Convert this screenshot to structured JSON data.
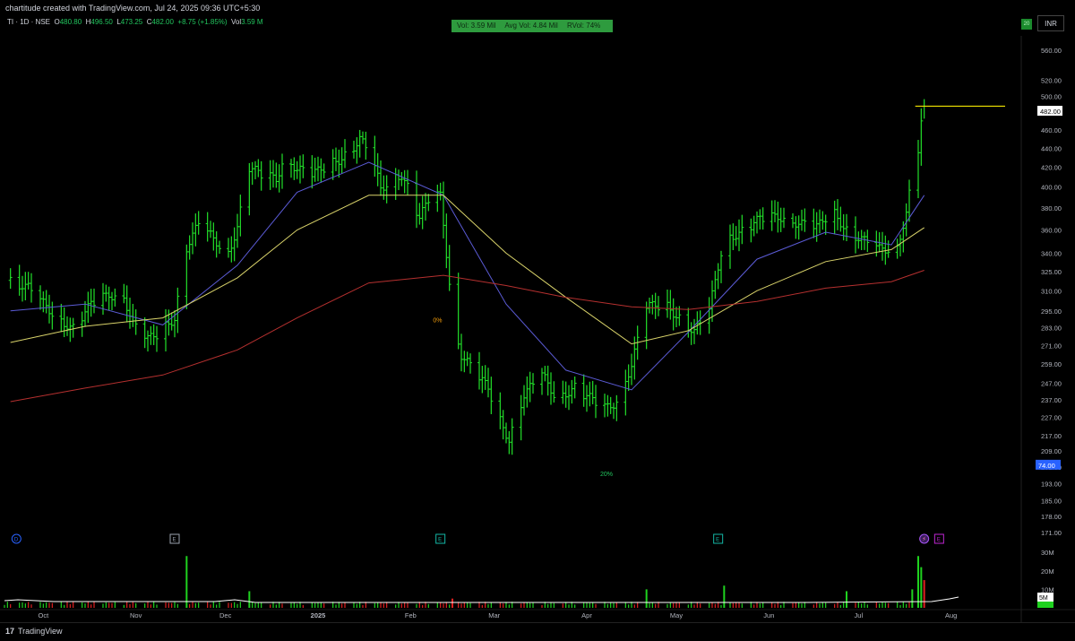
{
  "header": {
    "attribution": "chartitude created with TradingView.com, Jul 24, 2025 09:36 UTC+5:30",
    "symbol": "TI · 1D · NSE",
    "o_label": "O",
    "o_value": "480.80",
    "h_label": "H",
    "h_value": "496.50",
    "l_label": "L",
    "l_value": "473.25",
    "c_label": "C",
    "c_value": "482.00",
    "change": "+8.75 (+1.85%)",
    "vol_label": "Vol",
    "vol_value": "3.59 M",
    "badge": "20",
    "currency": "INR"
  },
  "volume_box": {
    "vol": "Vol: 3.59 Mil",
    "avg_vol": "Avg Vol: 4.84 Mil",
    "rvol": "RVol: 74%"
  },
  "footer": {
    "brand": "TradingView",
    "brand_mark": "17"
  },
  "colors": {
    "background": "#000000",
    "candle_up": "#22e02a",
    "ma_fast": "#5b5bd6",
    "ma_mid": "#d9d36a",
    "ma_slow": "#b5302f",
    "price_line": "#f2e400",
    "vol_up": "#1fd21f",
    "vol_down": "#e02020",
    "vol_avg": "#ffffff",
    "price_label_bg": "#ffffff",
    "blue_label_bg": "#2962ff"
  },
  "chart_data": {
    "type": "ohlc",
    "title": "TI · 1D · NSE",
    "x_tick_labels": [
      "Oct",
      "Nov",
      "Dec",
      "2025",
      "Feb",
      "Mar",
      "Apr",
      "May",
      "Jun",
      "Jul",
      "Aug"
    ],
    "y_tick_labels": [
      "560.00",
      "520.00",
      "500.00",
      "460.00",
      "440.00",
      "420.00",
      "400.00",
      "380.00",
      "360.00",
      "340.00",
      "325.00",
      "310.00",
      "295.00",
      "283.00",
      "271.00",
      "259.00",
      "247.00",
      "237.00",
      "227.00",
      "217.00",
      "209.00",
      "201.00",
      "193.00",
      "185.00",
      "178.00",
      "171.00"
    ],
    "price_scale": "log",
    "y_range": [
      165,
      600
    ],
    "last_price_label": "482.00",
    "blue_label": "74.00",
    "annotations": [
      {
        "text": "20%",
        "date": "2025-04-07",
        "price": 200
      },
      {
        "text": "0%",
        "date": "2025-02-10",
        "price": 292
      }
    ],
    "price_series": [
      {
        "date": "2024-09-20",
        "close": 318
      },
      {
        "date": "2024-09-26",
        "close": 312
      },
      {
        "date": "2024-10-01",
        "close": 300
      },
      {
        "date": "2024-10-07",
        "close": 288
      },
      {
        "date": "2024-10-11",
        "close": 282
      },
      {
        "date": "2024-10-17",
        "close": 300
      },
      {
        "date": "2024-10-23",
        "close": 307
      },
      {
        "date": "2024-10-28",
        "close": 306
      },
      {
        "date": "2024-10-31",
        "close": 285
      },
      {
        "date": "2024-11-05",
        "close": 275
      },
      {
        "date": "2024-11-09",
        "close": 280
      },
      {
        "date": "2024-11-14",
        "close": 290
      },
      {
        "date": "2024-11-18",
        "close": 345
      },
      {
        "date": "2024-11-22",
        "close": 365
      },
      {
        "date": "2024-11-27",
        "close": 352
      },
      {
        "date": "2024-12-02",
        "close": 340
      },
      {
        "date": "2024-12-05",
        "close": 362
      },
      {
        "date": "2024-12-09",
        "close": 420
      },
      {
        "date": "2024-12-13",
        "close": 412
      },
      {
        "date": "2024-12-18",
        "close": 408
      },
      {
        "date": "2024-12-21",
        "close": 432
      },
      {
        "date": "2024-12-25",
        "close": 418
      },
      {
        "date": "2024-12-30",
        "close": 412
      },
      {
        "date": "2025-01-03",
        "close": 420
      },
      {
        "date": "2025-01-08",
        "close": 428
      },
      {
        "date": "2025-01-12",
        "close": 438
      },
      {
        "date": "2025-01-15",
        "close": 450
      },
      {
        "date": "2025-01-19",
        "close": 430
      },
      {
        "date": "2025-01-22",
        "close": 398
      },
      {
        "date": "2025-01-26",
        "close": 410
      },
      {
        "date": "2025-01-29",
        "close": 412
      },
      {
        "date": "2025-02-01",
        "close": 392
      },
      {
        "date": "2025-02-04",
        "close": 370
      },
      {
        "date": "2025-02-07",
        "close": 388
      },
      {
        "date": "2025-02-11",
        "close": 392
      },
      {
        "date": "2025-02-15",
        "close": 290
      },
      {
        "date": "2025-02-18",
        "close": 265
      },
      {
        "date": "2025-02-23",
        "close": 252
      },
      {
        "date": "2025-02-27",
        "close": 244
      },
      {
        "date": "2025-03-03",
        "close": 225
      },
      {
        "date": "2025-03-06",
        "close": 215
      },
      {
        "date": "2025-03-11",
        "close": 240
      },
      {
        "date": "2025-03-17",
        "close": 252
      },
      {
        "date": "2025-03-22",
        "close": 238
      },
      {
        "date": "2025-03-28",
        "close": 244
      },
      {
        "date": "2025-04-02",
        "close": 238
      },
      {
        "date": "2025-04-07",
        "close": 232
      },
      {
        "date": "2025-04-11",
        "close": 236
      },
      {
        "date": "2025-04-16",
        "close": 258
      },
      {
        "date": "2025-04-21",
        "close": 298
      },
      {
        "date": "2025-04-27",
        "close": 300
      },
      {
        "date": "2025-05-02",
        "close": 290
      },
      {
        "date": "2025-05-07",
        "close": 280
      },
      {
        "date": "2025-05-12",
        "close": 295
      },
      {
        "date": "2025-05-17",
        "close": 352
      },
      {
        "date": "2025-05-23",
        "close": 358
      },
      {
        "date": "2025-05-29",
        "close": 370
      },
      {
        "date": "2025-06-05",
        "close": 372
      },
      {
        "date": "2025-06-12",
        "close": 365
      },
      {
        "date": "2025-06-17",
        "close": 362
      },
      {
        "date": "2025-06-22",
        "close": 378
      },
      {
        "date": "2025-06-27",
        "close": 360
      },
      {
        "date": "2025-07-03",
        "close": 350
      },
      {
        "date": "2025-07-08",
        "close": 343
      },
      {
        "date": "2025-07-14",
        "close": 345
      },
      {
        "date": "2025-07-17",
        "close": 375
      },
      {
        "date": "2025-07-19",
        "close": 410
      },
      {
        "date": "2025-07-21",
        "close": 440
      },
      {
        "date": "2025-07-22",
        "close": 470
      },
      {
        "date": "2025-07-23",
        "close": 482
      }
    ],
    "moving_averages": [
      {
        "name": "",
        "color_key": "ma_fast",
        "points": [
          {
            "date": "2024-09-20",
            "value": 295
          },
          {
            "date": "2024-10-15",
            "value": 300
          },
          {
            "date": "2024-11-10",
            "value": 285
          },
          {
            "date": "2024-12-05",
            "value": 330
          },
          {
            "date": "2024-12-25",
            "value": 395
          },
          {
            "date": "2025-01-18",
            "value": 425
          },
          {
            "date": "2025-02-12",
            "value": 392
          },
          {
            "date": "2025-03-05",
            "value": 300
          },
          {
            "date": "2025-03-25",
            "value": 255
          },
          {
            "date": "2025-04-16",
            "value": 243
          },
          {
            "date": "2025-05-05",
            "value": 280
          },
          {
            "date": "2025-05-28",
            "value": 335
          },
          {
            "date": "2025-06-20",
            "value": 358
          },
          {
            "date": "2025-07-12",
            "value": 347
          },
          {
            "date": "2025-07-23",
            "value": 392
          }
        ]
      },
      {
        "name": "",
        "color_key": "ma_mid",
        "points": [
          {
            "date": "2024-09-20",
            "value": 273
          },
          {
            "date": "2024-10-15",
            "value": 284
          },
          {
            "date": "2024-11-10",
            "value": 290
          },
          {
            "date": "2024-12-05",
            "value": 320
          },
          {
            "date": "2024-12-25",
            "value": 360
          },
          {
            "date": "2025-01-18",
            "value": 392
          },
          {
            "date": "2025-02-12",
            "value": 392
          },
          {
            "date": "2025-03-05",
            "value": 340
          },
          {
            "date": "2025-03-25",
            "value": 305
          },
          {
            "date": "2025-04-16",
            "value": 272
          },
          {
            "date": "2025-05-05",
            "value": 281
          },
          {
            "date": "2025-05-28",
            "value": 310
          },
          {
            "date": "2025-06-20",
            "value": 333
          },
          {
            "date": "2025-07-12",
            "value": 343
          },
          {
            "date": "2025-07-23",
            "value": 362
          }
        ]
      },
      {
        "name": "",
        "color_key": "ma_slow",
        "points": [
          {
            "date": "2024-09-20",
            "value": 236
          },
          {
            "date": "2024-10-15",
            "value": 244
          },
          {
            "date": "2024-11-10",
            "value": 252
          },
          {
            "date": "2024-12-05",
            "value": 268
          },
          {
            "date": "2024-12-25",
            "value": 290
          },
          {
            "date": "2025-01-18",
            "value": 316
          },
          {
            "date": "2025-02-12",
            "value": 322
          },
          {
            "date": "2025-03-05",
            "value": 314
          },
          {
            "date": "2025-03-25",
            "value": 305
          },
          {
            "date": "2025-04-16",
            "value": 298
          },
          {
            "date": "2025-05-05",
            "value": 296
          },
          {
            "date": "2025-05-28",
            "value": 302
          },
          {
            "date": "2025-06-20",
            "value": 312
          },
          {
            "date": "2025-07-12",
            "value": 317
          },
          {
            "date": "2025-07-23",
            "value": 326
          }
        ]
      }
    ],
    "volume": {
      "y_tick_labels": [
        "30M",
        "20M",
        "10M"
      ],
      "last_label": "5M",
      "spikes": [
        {
          "date": "2024-11-18",
          "value": 28,
          "dir": "up"
        },
        {
          "date": "2024-12-09",
          "value": 9,
          "dir": "up"
        },
        {
          "date": "2025-02-15",
          "value": 5,
          "dir": "down"
        },
        {
          "date": "2025-04-21",
          "value": 10,
          "dir": "up"
        },
        {
          "date": "2025-05-17",
          "value": 12,
          "dir": "up"
        },
        {
          "date": "2025-06-27",
          "value": 9,
          "dir": "up"
        },
        {
          "date": "2025-07-19",
          "value": 10,
          "dir": "up"
        },
        {
          "date": "2025-07-21",
          "value": 28,
          "dir": "up"
        },
        {
          "date": "2025-07-22",
          "value": 22,
          "dir": "up"
        },
        {
          "date": "2025-07-23",
          "value": 15,
          "dir": "down"
        }
      ]
    },
    "events": [
      {
        "label": "D",
        "date": "2024-09-22",
        "kind": "dividend"
      },
      {
        "label": "E",
        "date": "2024-11-14",
        "kind": "earnings"
      },
      {
        "label": "E",
        "date": "2025-02-11",
        "kind": "earnings"
      },
      {
        "label": "E",
        "date": "2025-05-15",
        "kind": "earnings"
      },
      {
        "label": "",
        "date": "2025-07-23",
        "kind": "flash"
      },
      {
        "label": "E",
        "date": "2025-07-28",
        "kind": "upcoming-earnings"
      }
    ]
  }
}
